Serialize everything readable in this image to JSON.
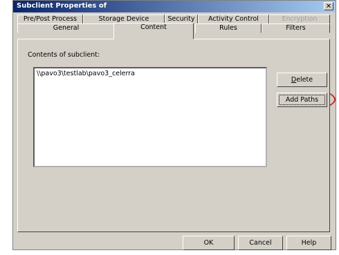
{
  "dialog": {
    "title": "Subclient Properties of",
    "close_glyph": "✕"
  },
  "tabs_top": [
    {
      "label": "Pre/Post Process",
      "disabled": false
    },
    {
      "label": "Storage Device",
      "disabled": false
    },
    {
      "label": "Security",
      "disabled": false
    },
    {
      "label": "Activity Control",
      "disabled": false
    },
    {
      "label": "Encryption",
      "disabled": true
    }
  ],
  "tabs_bottom": [
    {
      "label": "General"
    },
    {
      "label": "Content",
      "active": true
    },
    {
      "label": "Rules"
    },
    {
      "label": "Filters"
    }
  ],
  "content": {
    "label": "Contents of subclient:",
    "items": [
      "\\\\pavo3\\testlab\\pavo3_celerra"
    ],
    "delete_label_mnemonic": "D",
    "delete_label_rest": "elete",
    "add_paths_label": "Add Paths"
  },
  "footer": {
    "ok": "OK",
    "cancel": "Cancel",
    "help": "Help"
  },
  "colors": {
    "dialog_bg": "#d4d0c8",
    "title_start": "#0a246a",
    "title_end": "#a6caf0",
    "highlight": "#c0262c"
  }
}
